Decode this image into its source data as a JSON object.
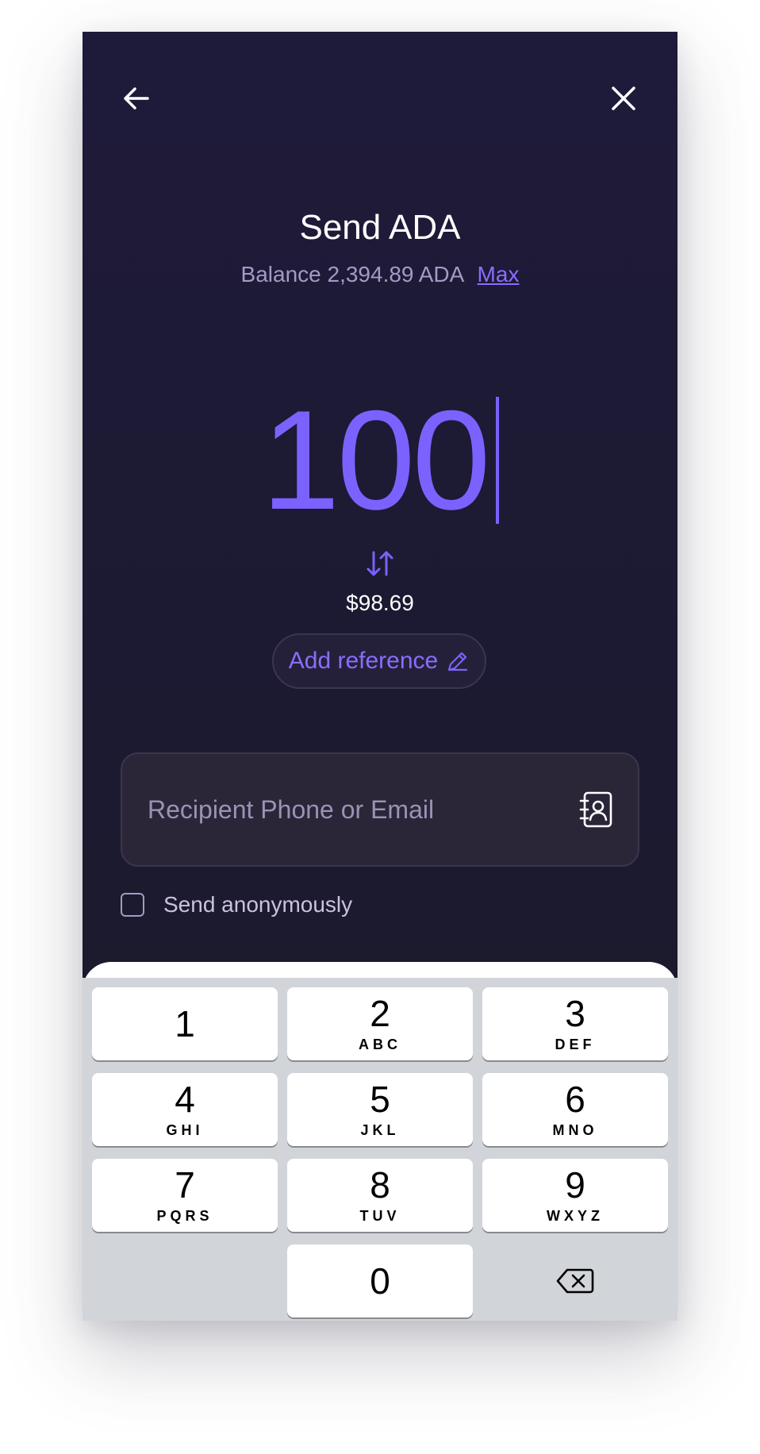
{
  "header": {
    "title": "Send ADA",
    "balance_label": "Balance 2,394.89 ADA",
    "max_label": "Max"
  },
  "amount": {
    "value": "100",
    "fiat_equivalent": "$98.69"
  },
  "reference": {
    "label": "Add reference"
  },
  "recipient": {
    "placeholder": "Recipient Phone or Email",
    "value": ""
  },
  "anonymous": {
    "label": "Send anonymously",
    "checked": false
  },
  "keypad": {
    "keys": [
      {
        "num": "1",
        "letters": ""
      },
      {
        "num": "2",
        "letters": "ABC"
      },
      {
        "num": "3",
        "letters": "DEF"
      },
      {
        "num": "4",
        "letters": "GHI"
      },
      {
        "num": "5",
        "letters": "JKL"
      },
      {
        "num": "6",
        "letters": "MNO"
      },
      {
        "num": "7",
        "letters": "PQRS"
      },
      {
        "num": "8",
        "letters": "TUV"
      },
      {
        "num": "9",
        "letters": "WXYZ"
      },
      {
        "num": "0",
        "letters": ""
      }
    ]
  },
  "icons": {
    "back": "arrow-left-icon",
    "close": "close-icon",
    "swap": "swap-vertical-icon",
    "edit": "pencil-icon",
    "contacts": "contacts-book-icon",
    "delete": "backspace-icon"
  },
  "colors": {
    "accent": "#7b62ff",
    "background": "#1e1a3a",
    "keyboard": "#d1d4d9"
  }
}
